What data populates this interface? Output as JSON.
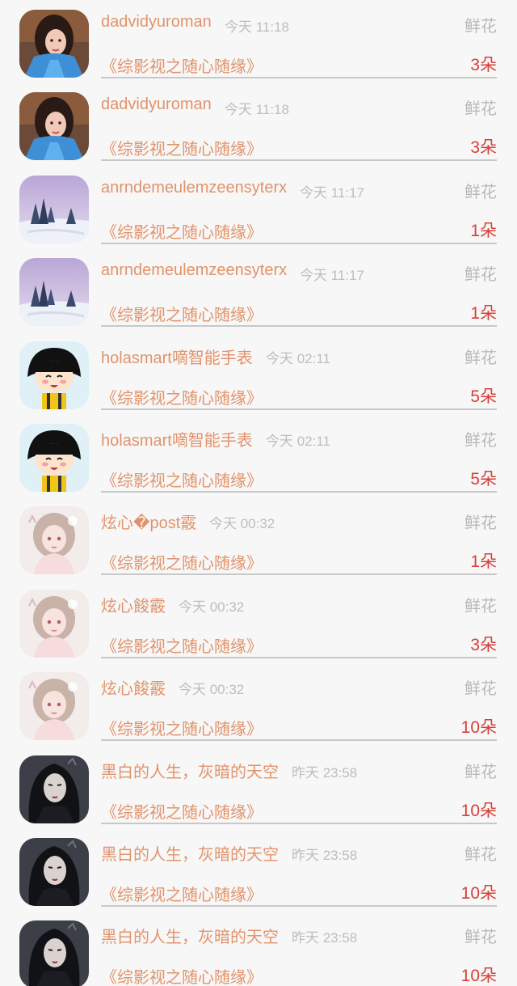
{
  "items": [
    {
      "user": "dadvidyuroman",
      "time": "今天 11:18",
      "tag": "鲜花",
      "work": "《综影视之随心随缘》",
      "count": "3朵",
      "avatar": "girl-blue-icon"
    },
    {
      "user": "dadvidyuroman",
      "time": "今天 11:18",
      "tag": "鲜花",
      "work": "《综影视之随心随缘》",
      "count": "3朵",
      "avatar": "girl-blue-icon"
    },
    {
      "user": "anrndemeulemzeensyterx",
      "time": "今天 11:17",
      "tag": "鲜花",
      "work": "《综影视之随心随缘》",
      "count": "1朵",
      "avatar": "snow-landscape-icon"
    },
    {
      "user": "anrndemeulemzeensyterx",
      "time": "今天 11:17",
      "tag": "鲜花",
      "work": "《综影视之随心随缘》",
      "count": "1朵",
      "avatar": "snow-landscape-icon"
    },
    {
      "user": "holasmart嘀智能手表",
      "time": "今天 02:11",
      "tag": "鲜花",
      "work": "《综影视之随心随缘》",
      "count": "5朵",
      "avatar": "cartoon-girl-icon"
    },
    {
      "user": "holasmart嘀智能手表",
      "time": "今天 02:11",
      "tag": "鲜花",
      "work": "《综影视之随心随缘》",
      "count": "5朵",
      "avatar": "cartoon-girl-icon"
    },
    {
      "user": "炫心�post霰",
      "time": "今天 00:32",
      "tag": "鲜花",
      "work": "《综影视之随心随缘》",
      "count": "1朵",
      "avatar": "anime-girl-icon"
    },
    {
      "user": "炫心餕霰",
      "time": "今天 00:32",
      "tag": "鲜花",
      "work": "《综影视之随心随缘》",
      "count": "3朵",
      "avatar": "anime-girl-icon"
    },
    {
      "user": "炫心餕霰",
      "time": "今天 00:32",
      "tag": "鲜花",
      "work": "《综影视之随心随缘》",
      "count": "10朵",
      "avatar": "anime-girl-icon"
    },
    {
      "user": "黑白的人生，灰暗的天空",
      "time": "昨天 23:58",
      "tag": "鲜花",
      "work": "《综影视之随心随缘》",
      "count": "10朵",
      "avatar": "dark-warrior-icon"
    },
    {
      "user": "黑白的人生，灰暗的天空",
      "time": "昨天 23:58",
      "tag": "鲜花",
      "work": "《综影视之随心随缘》",
      "count": "10朵",
      "avatar": "dark-warrior-icon"
    },
    {
      "user": "黑白的人生，灰暗的天空",
      "time": "昨天 23:58",
      "tag": "鲜花",
      "work": "《综影视之随心随缘》",
      "count": "10朵",
      "avatar": "dark-warrior-icon"
    }
  ],
  "colors": {
    "background": "#f7f7f7",
    "name": "#e2936b",
    "count": "#d6403a",
    "muted": "#b8b8b8",
    "divider": "#c8c8c8"
  }
}
